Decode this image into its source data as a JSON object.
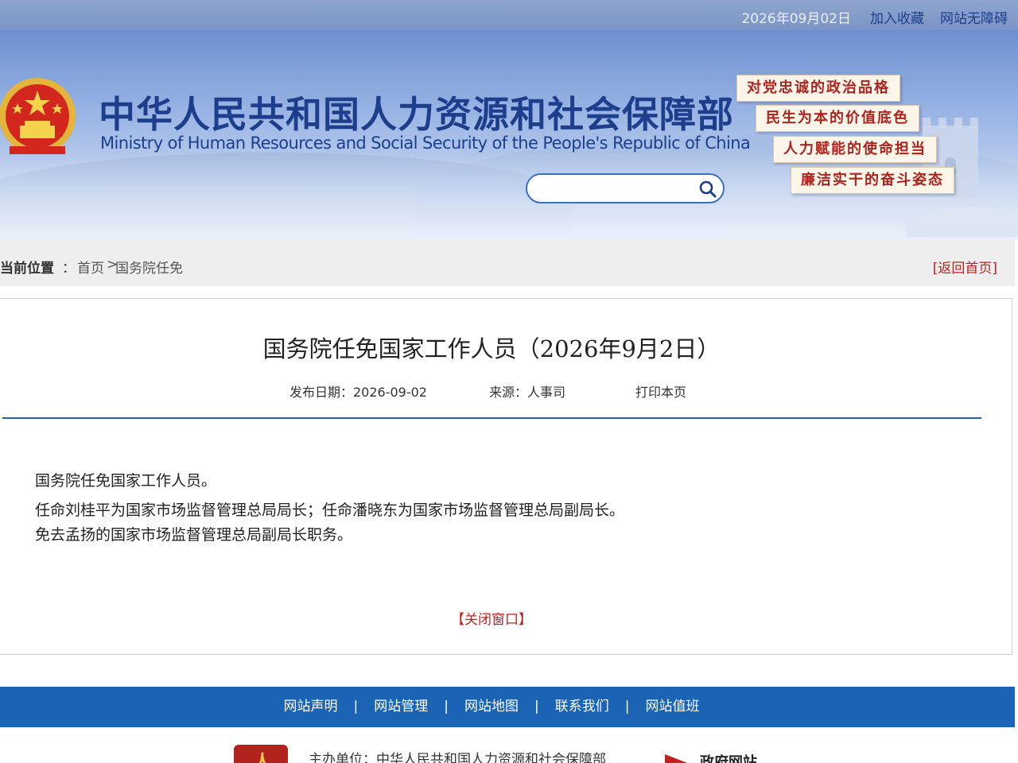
{
  "topbar": {
    "date": "2026年09月02日",
    "add_favorite": "加入收藏",
    "accessibility": "网站无障碍"
  },
  "header": {
    "title_cn": "中华人民共和国人力资源和社会保障部",
    "title_en": "Ministry of Human Resources and Social Security of the People's Republic of China",
    "search_placeholder": "",
    "slogans": [
      "对党忠诚的政治品格",
      "民生为本的价值底色",
      "人力赋能的使命担当",
      "廉洁实干的奋斗姿态"
    ]
  },
  "breadcrumb": {
    "label": "当前位置",
    "separator": "：",
    "home": "首页",
    "arrow": ">",
    "current": "国务院任免",
    "back_home": "[返回首页]"
  },
  "article": {
    "title": "国务院任免国家工作人员（2026年9月2日）",
    "publish_date": "发布日期：2026-09-02",
    "source": "来源：人事司",
    "print": "打印本页",
    "paragraphs": [
      "国务院任免国家工作人员。",
      "任命刘桂平为国家市场监督管理总局局长；任命潘晓东为国家市场监督管理总局副局长。",
      "免去孟扬的国家市场监督管理总局副局长职务。"
    ],
    "close": "【关闭窗口】"
  },
  "footer": {
    "links": [
      "网站声明",
      "网站管理",
      "网站地图",
      "联系我们",
      "网站值班"
    ],
    "separator": "|",
    "host": "主办单位：中华人民共和国人力资源和社会保障部",
    "gov_site": "政府网站",
    "emblem_char": "人"
  },
  "colors": {
    "brand_blue": "#1d3e8c",
    "footer_blue": "#1b64b5",
    "accent_red": "#c0201e"
  }
}
